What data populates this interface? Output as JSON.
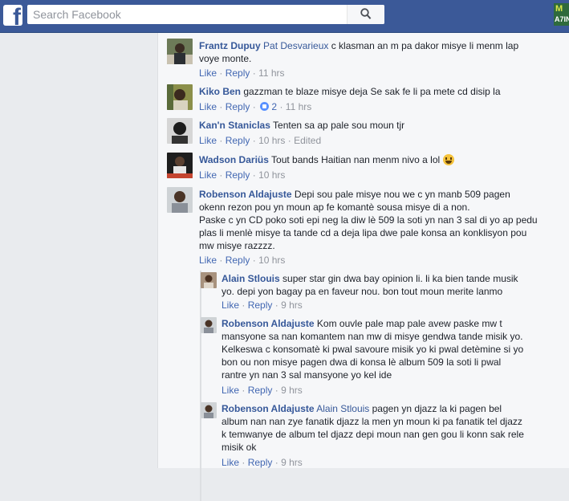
{
  "header": {
    "logo": "f",
    "search_placeholder": "Search Facebook",
    "corner_badge_top": "M",
    "corner_badge_bottom": "A7IN"
  },
  "actions": {
    "like": "Like",
    "reply": "Reply",
    "separator": "·"
  },
  "comments": [
    {
      "author": "Frantz Dupuy",
      "mention": "Pat Desvarieux",
      "text_line1": " c klasman an m pa dakor misye li menm lap",
      "text_line2": "voye monte.",
      "time": "11 hrs"
    },
    {
      "author": "Kiko Ben",
      "text_line1": "gazzman te blaze misye deja Se sak fe li pa mete cd disip la",
      "reaction_count": "2",
      "time": "11 hrs"
    },
    {
      "author": "Kan'n Staniclas",
      "text_line1": "Tenten sa ap pale sou moun tjr",
      "time": "10 hrs",
      "edited": "Edited"
    },
    {
      "author": "Wadson Dariüs",
      "text_line1": "Tout bands Haitian nan menm nivo a lol",
      "time": "10 hrs"
    },
    {
      "author": "Robenson Aldajuste",
      "text_line1": "Depi sou pale misye nou we c yn manb 509 pagen",
      "text_line2": "okenn rezon pou yn moun ap fe komantè sousa misye di a non.",
      "text_line3": "Paske c yn CD poko soti epi neg la diw lè 509 la soti yn nan 3 sal di yo ap pedu",
      "text_line4": "plas li menlè misye ta tande cd a deja lipa dwe pale konsa an konklisyon pou",
      "text_line5": "mw misye razzzz.",
      "time": "10 hrs"
    }
  ],
  "replies": [
    {
      "author": "Alain Stlouis",
      "text_line1": "super star gin dwa bay opinion li. li ka bien tande musik",
      "text_line2": "yo. depi yon bagay pa en faveur nou. bon tout moun merite lanmo",
      "time": "9 hrs"
    },
    {
      "author": "Robenson Aldajuste",
      "text_line1": "Kom ouvle pale map pale avew paske mw t",
      "text_line2": "mansyone sa nan komantem nan mw di misye gendwa tande misik yo.",
      "text_line3": "Kelkeswa c konsomatè ki pwal savoure misik yo ki pwal detèmine si yo",
      "text_line4": "bon ou non misye pagen dwa di konsa lè album 509 la soti li pwal",
      "text_line5": "rantre yn nan 3 sal mansyone yo kel ide",
      "time": "9 hrs"
    },
    {
      "author": "Robenson Aldajuste",
      "mention": "Alain Stlouis",
      "text_line1": " pagen yn djazz la ki pagen bel",
      "text_line2": "album nan nan zye fanatik djazz la men yn moun ki pa fanatik tel djazz",
      "text_line3": "k temwanye de album tel djazz depi moun nan gen gou li konn sak rele",
      "text_line4": "misik ok",
      "time": "9 hrs"
    }
  ],
  "colors": {
    "topbar": "#3b5998",
    "author": "#365899",
    "link": "#4267b2",
    "meta": "#90949c",
    "background": "#e9ebee"
  }
}
